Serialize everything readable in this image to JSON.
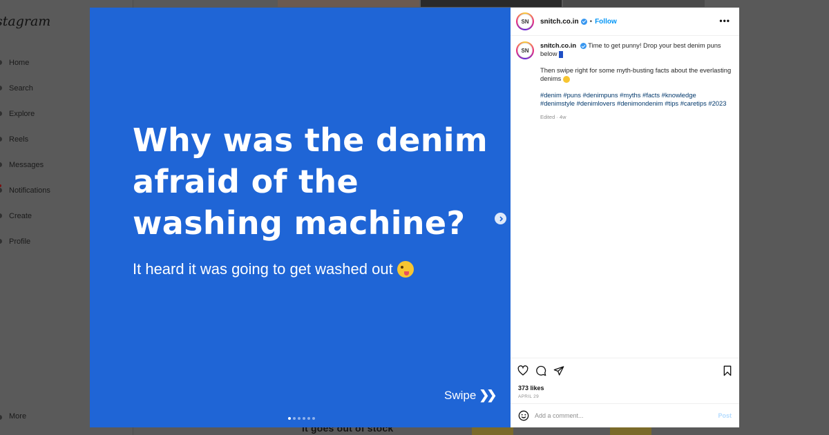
{
  "background": {
    "logo": "stagram",
    "nav": [
      {
        "label": "Home"
      },
      {
        "label": "Search"
      },
      {
        "label": "Explore"
      },
      {
        "label": "Reels"
      },
      {
        "label": "Messages"
      },
      {
        "label": "Notifications"
      },
      {
        "label": "Create"
      },
      {
        "label": "Profile"
      }
    ],
    "more": "More",
    "bottom_text": "it goes out of stock"
  },
  "slide": {
    "headline": "Why was the denim afraid of the washing machine?",
    "punchline": "It heard it was going to get washed out",
    "swipe": "Swipe",
    "swipe_arrows": "❯❯",
    "color": "#1f65d6",
    "dots": 6,
    "active_dot": 0
  },
  "post": {
    "username": "snitch.co.in",
    "separator": "•",
    "follow": "Follow",
    "more": "•••",
    "avatar_text": "SN",
    "caption_line1": "Time to get punny! Drop your best denim puns below",
    "caption_line2": "Then swipe right for some myth-busting facts about the everlasting denims",
    "hashtags": "#denim #puns #denimpuns #myths #facts #knowledge #denimstyle #denimlovers #denimondenim #tips #caretips #2023",
    "edited": "Edited · 4w",
    "likes": "373 likes",
    "date": "APRIL 29",
    "comment_placeholder": "Add a comment...",
    "post_button": "Post"
  },
  "icons": {
    "like": "heart-icon",
    "comment": "comment-icon",
    "share": "send-icon",
    "save": "bookmark-icon",
    "emoji": "smiley-icon",
    "next": "chevron-right-icon",
    "more": "more-options-icon"
  }
}
